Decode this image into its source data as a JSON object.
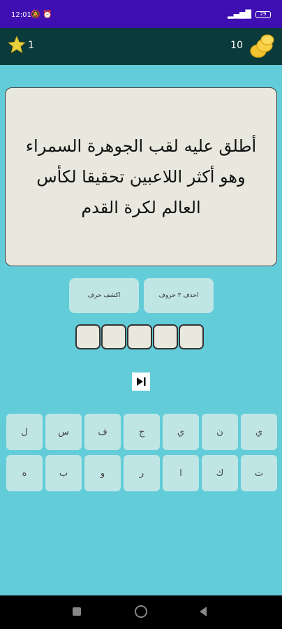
{
  "status_bar": {
    "time": "12:01",
    "left_icons": "🔕 ⏰",
    "signal": "▂▄▆█",
    "battery": "29"
  },
  "top_bar": {
    "stars": "1",
    "coins": "10"
  },
  "question": {
    "text": "أطلق عليه لقب الجوهرة السمراء وهو أكثر اللاعبين تحقيقا لكأس العالم لكرة القدم"
  },
  "help": {
    "remove_letters": "احذف ٣ حروف",
    "reveal_letter": "اكشف حرف"
  },
  "answer_slots": [
    "",
    "",
    "",
    "",
    ""
  ],
  "keyboard": {
    "row1": [
      "ي",
      "ن",
      "ي",
      "ج",
      "ف",
      "س",
      "ل"
    ],
    "row2": [
      "ت",
      "ك",
      "ا",
      "ر",
      "و",
      "ب",
      "ه"
    ]
  },
  "colors": {
    "background": "#62ccd9",
    "status_bar": "#3f0fb2",
    "top_bar": "#0a3a39",
    "card": "#e9e8de",
    "key": "#bfe6e4"
  }
}
